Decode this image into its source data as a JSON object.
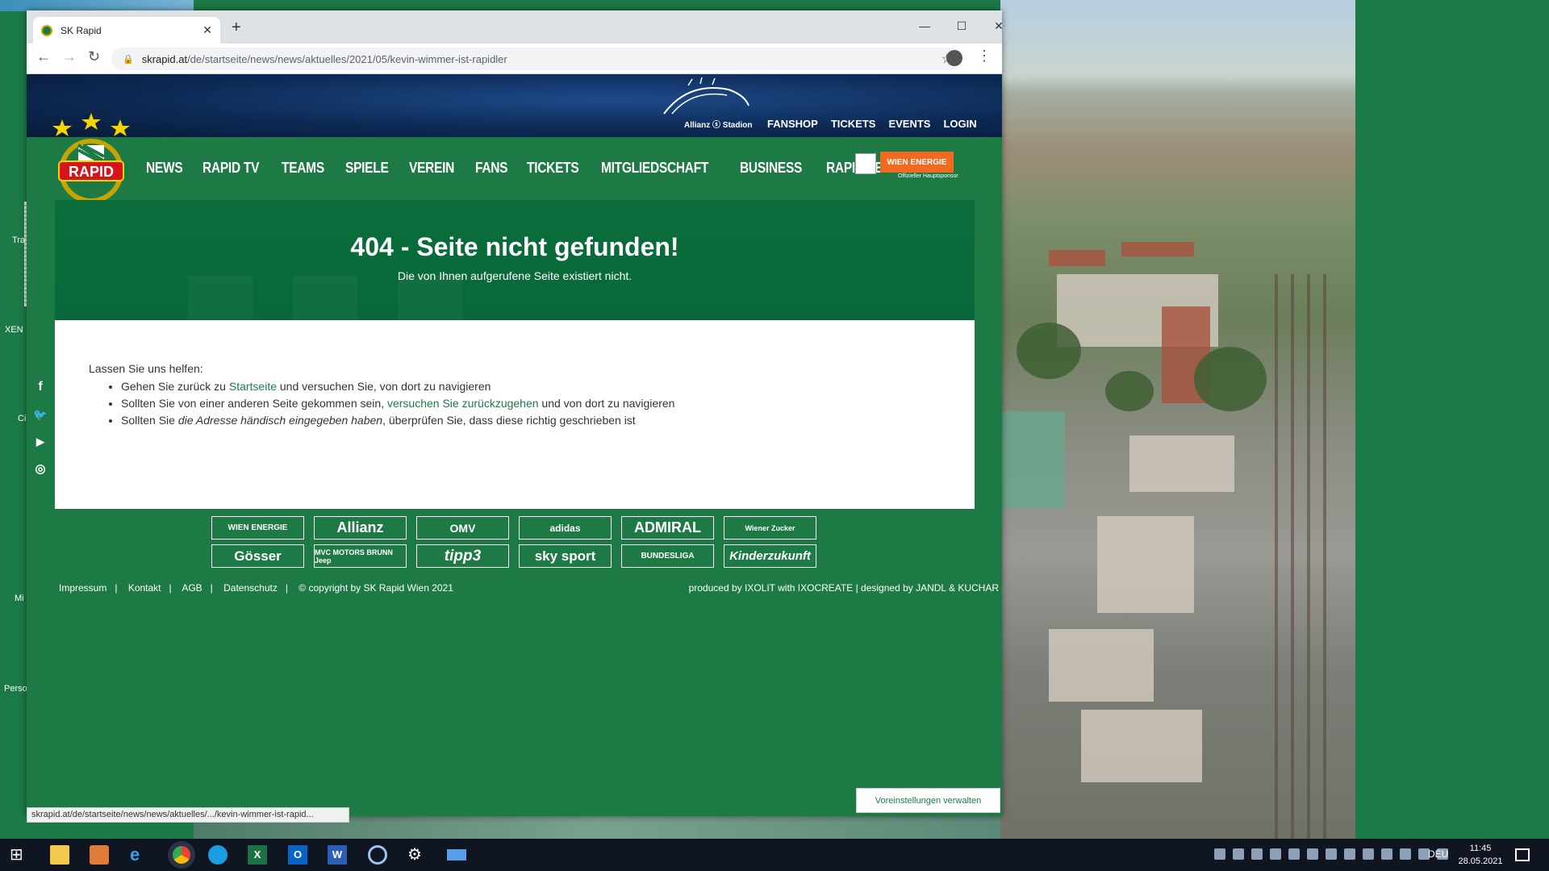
{
  "browser": {
    "tab_title": "SK Rapid",
    "new_tab": "+",
    "url_host": "skrapid.at",
    "url_path": "/de/startseite/news/news/aktuelles/2021/05/kevin-wimmer-ist-rapidler",
    "status_url": "skrapid.at/de/startseite/news/news/aktuelles/.../kevin-wimmer-ist-rapid..."
  },
  "site": {
    "logo_text": "RAPID",
    "stadion": "Allianz ⓢ Stadion",
    "top_links": [
      "FANSHOP",
      "TICKETS",
      "EVENTS",
      "LOGIN"
    ],
    "nav": [
      "NEWS",
      "RAPID TV",
      "TEAMS",
      "SPIELE",
      "VEREIN",
      "FANS",
      "TICKETS",
      "MITGLIEDSCHAFT",
      "BUSINESS",
      "RAPID LEBEN"
    ],
    "main_sponsor": "WIEN ENERGIE",
    "main_sponsor_sub": "Offizieller Hauptsponsor",
    "hero_title": "404 - Seite nicht gefunden!",
    "hero_sub": "Die von Ihnen aufgerufene Seite existiert nicht.",
    "help_intro": "Lassen Sie uns helfen:",
    "help_1_a": "Gehen Sie zurück zu ",
    "help_1_link": "Startseite",
    "help_1_b": " und versuchen Sie, von dort zu navigieren",
    "help_2_a": "Sollten Sie von einer anderen Seite gekommen sein, ",
    "help_2_link": "versuchen Sie zurückzugehen",
    "help_2_b": " und von dort zu navigieren",
    "help_3_a": "Sollten Sie ",
    "help_3_em": "die Adresse händisch eingegeben haben",
    "help_3_b": ", überprüfen Sie, dass diese richtig geschrieben ist",
    "sponsors": [
      "WIEN ENERGIE",
      "Allianz",
      "OMV",
      "adidas",
      "ADMIRAL",
      "Wiener Zucker",
      "Gösser",
      "MVC MOTORS BRUNN Jeep",
      "tipp3",
      "sky sport",
      "BUNDESLIGA",
      "Kinderzukunft"
    ],
    "footer_links": [
      "Impressum",
      "Kontakt",
      "AGB",
      "Datenschutz",
      "© copyright by SK Rapid Wien 2021"
    ],
    "footer_right": "produced by IXOLIT with IXOCREATE  |  designed by JANDL & KUCHAR",
    "prefs_button": "Voreinstellungen verwalten"
  },
  "desktop": {
    "labels": [
      "Tra",
      "XEN",
      "Ci",
      "Mi",
      "Perso"
    ]
  },
  "taskbar": {
    "lang": "DEU",
    "time": "11:45",
    "date": "28.05.2021"
  },
  "colors": {
    "rapid_green": "#1d7a45",
    "hero_green": "#08683a",
    "wien_energie_orange": "#f26a22"
  }
}
